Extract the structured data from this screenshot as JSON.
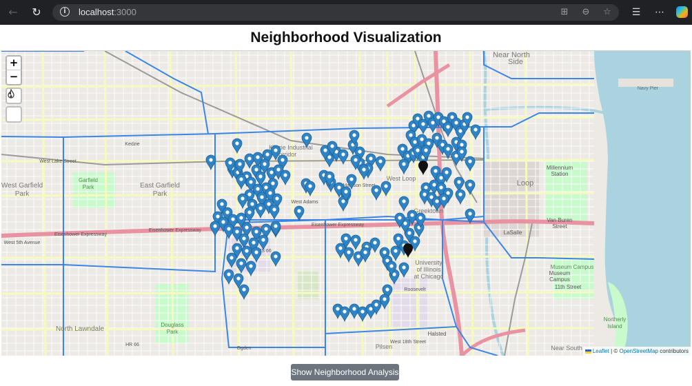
{
  "browser": {
    "url_host": "localhost",
    "url_port": ":3000"
  },
  "page": {
    "title": "Neighborhood Visualization"
  },
  "map": {
    "zoom_in_label": "+",
    "zoom_out_label": "−",
    "labels": {
      "near_north": "Near North",
      "side": "Side",
      "west_garfield": "West Garfield",
      "park1": "Park",
      "east_garfield": "East Garfield",
      "park2": "Park",
      "garfield_park": "Garfield",
      "park3": "Park",
      "loop": "Loop",
      "kedzie": "Kedzie",
      "kinzie_industrial": "Kinzie Industrial",
      "corridor": "Corridor",
      "west_loop": "West Loop",
      "greektown": "Greektown",
      "university": "University",
      "of_illinois": "of Illinois",
      "at_chicago": "at Chicago",
      "north_lawndale": "North Lawndale",
      "douglass_park": "Douglass",
      "park4": "Park",
      "museum_campus": "Museum Campus",
      "northerly_island": "Northerly",
      "island": "Island",
      "millennium": "Millennium",
      "station": "Station",
      "van_buren": "Van Buren",
      "street": "Street",
      "lasalle": "LaSalle",
      "museum": "Museum",
      "campus": "Campus",
      "eleventh": "11th Street",
      "near_south": "Near South",
      "pilsen": "Pilsen",
      "halsted": "Halsted",
      "eisenhower1": "Eisenhower Expressway",
      "eisenhower2": "Eisenhower Expressway",
      "eisenhower3": "Eisenhower Expressway",
      "west_lake": "West Lake Street",
      "west_madison": "West Madison Street",
      "west_adams": "West Adams",
      "west_18th": "West 18th Street",
      "west_5th": "West 5th Avenue",
      "navy_pier": "Navy Pier",
      "hist_us66": "Hist US 66",
      "hr66": "HR 66",
      "ogden": "Ogden",
      "roosevelt": "Roosevelt"
    }
  },
  "attribution": {
    "leaflet": "Leaflet",
    "sep": " | © ",
    "osm": "OpenStreetMap",
    "suffix": " contributors"
  },
  "analysis_button": {
    "label": "Show Neighborhood Analysis"
  },
  "colors": {
    "marker": "#2f84c6",
    "boundary": "#3a85e6",
    "water": "#aad3df",
    "park": "#c8facc",
    "expressway": "#e892a2"
  },
  "icons": {
    "back": "arrow-left-icon",
    "reload": "reload-icon",
    "info": "info-icon",
    "heatmap": "fire-icon"
  }
}
